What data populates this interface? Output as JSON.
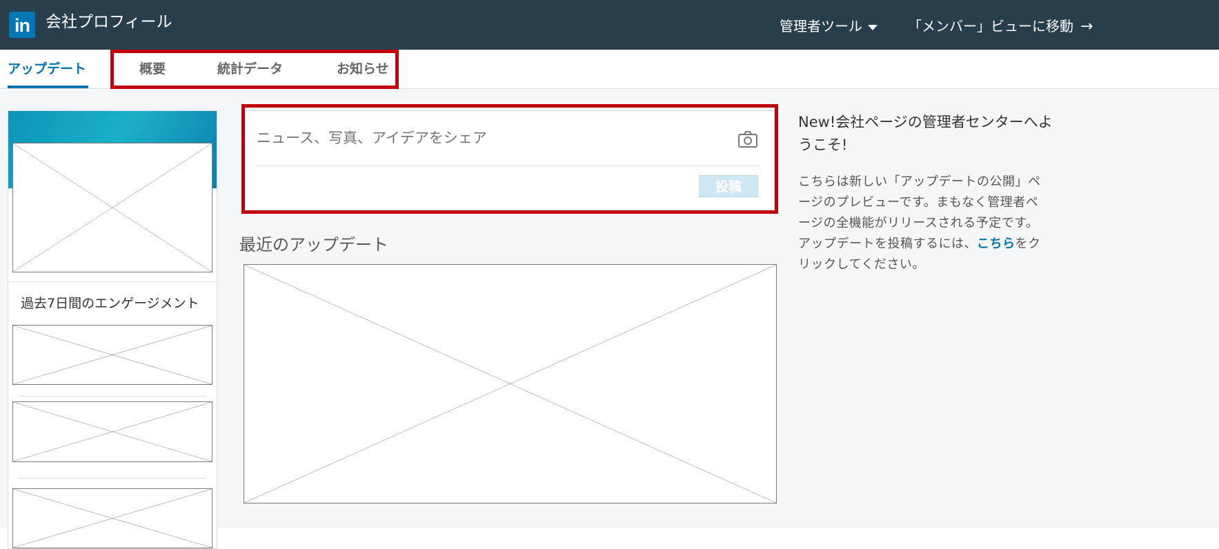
{
  "header": {
    "logo_text": "in",
    "title": "会社プロフィール",
    "admin_tools_label": "管理者ツール",
    "member_view_label": "「メンバー」ビューに移動"
  },
  "tabs": [
    {
      "label": "アップデート",
      "active": true
    },
    {
      "label": "概要",
      "active": false
    },
    {
      "label": "統計データ",
      "active": false
    },
    {
      "label": "お知らせ",
      "active": false
    }
  ],
  "left_panel": {
    "engagement_title": "過去7日間のエンゲージメント"
  },
  "share": {
    "placeholder": "ニュース、写真、アイデアをシェア",
    "post_label": "投稿"
  },
  "feed": {
    "recent_title": "最近のアップデート"
  },
  "side_panel": {
    "title": "New!会社ページの管理者センターへようこそ!",
    "text_before_link": "こちらは新しい「アップデートの公開」ページのプレビューです。まもなく管理者ページの全機能がリリースされる予定です。アップデートを投稿するには、",
    "link_label": "こちら",
    "text_after_link": "をクリックしてください。"
  },
  "colors": {
    "topbar": "#283e4a",
    "accent": "#0073b1",
    "highlight_border": "#c0000c",
    "post_button_disabled": "#cfe6f3"
  },
  "icons": {
    "logo": "linkedin-logo-icon",
    "admin_dropdown": "caret-down-icon",
    "member_view": "arrow-right-icon",
    "camera": "camera-icon"
  }
}
